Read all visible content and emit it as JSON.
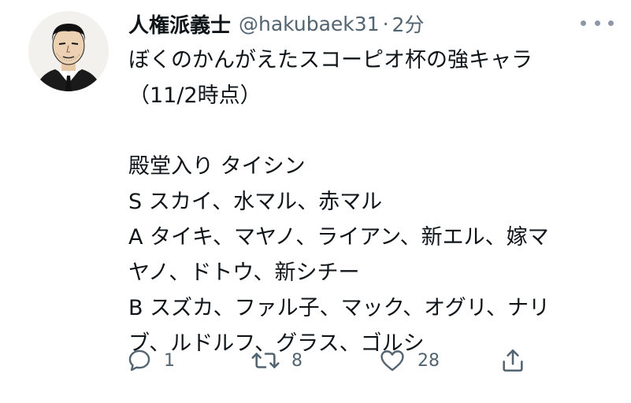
{
  "tweet": {
    "display_name": "人権派義士",
    "handle": "@hakubaek31",
    "separator": "·",
    "time": "2分",
    "lines": [
      "ぼくのかんがえたスコーピオ杯の強キャラ",
      "（11/2時点）",
      "",
      "殿堂入り タイシン",
      "S スカイ、水マル、赤マル",
      "A タイキ、マヤノ、ライアン、新エル、嫁マ",
      "ヤノ、ドトウ、新シチー",
      "B スズカ、ファル子、マック、オグリ、ナリ",
      "ブ、ルドルフ、グラス、ゴルシ"
    ]
  },
  "actions": {
    "reply_count": "1",
    "retweet_count": "8",
    "like_count": "28"
  },
  "icons": {
    "reply": "reply-icon",
    "retweet": "retweet-icon",
    "like": "heart-icon",
    "share": "share-icon",
    "more": "more-icon"
  },
  "colors": {
    "text": "#0f1419",
    "secondary": "#536471"
  }
}
